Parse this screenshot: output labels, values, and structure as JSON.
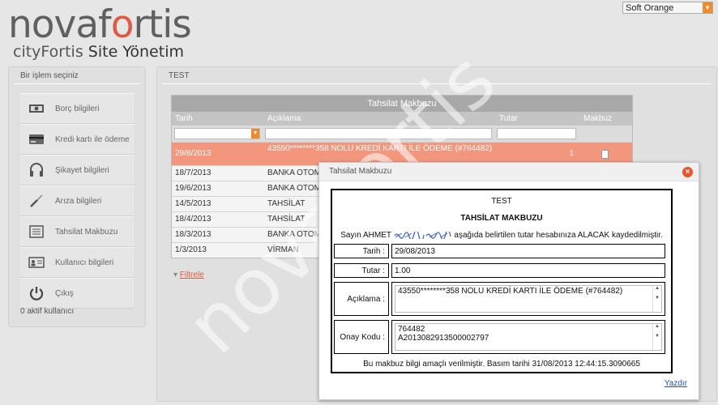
{
  "logo": {
    "brand": "novafortis",
    "tagline_prefix": "cityFortis",
    "tagline_rest": "Site Yönetim"
  },
  "theme": {
    "selected": "Soft Orange"
  },
  "left_panel": {
    "title": "Bir işlem seçiniz",
    "items": [
      {
        "label": "Borç bilgileri",
        "icon": "money-icon"
      },
      {
        "label": "Kredi kartı ile ödeme",
        "icon": "credit-card-icon"
      },
      {
        "label": "Şikayet bilgileri",
        "icon": "headset-icon"
      },
      {
        "label": "Arıza bilgileri",
        "icon": "screwdriver-icon"
      },
      {
        "label": "Tahsilat Makbuzu",
        "icon": "receipt-icon"
      },
      {
        "label": "Kullanıcı bilgileri",
        "icon": "user-card-icon"
      },
      {
        "label": "Çıkış",
        "icon": "power-icon"
      }
    ],
    "active_users": "0 aktif kullanıcı"
  },
  "main_panel": {
    "title": "TEST",
    "grid": {
      "caption": "Tahsilat Makbuzu",
      "columns": [
        "Tarih",
        "Açıklama",
        "Tutar",
        "Makbuz"
      ],
      "rows": [
        {
          "date": "29/8/2013",
          "desc": "43550********358 NOLU KREDİ KARTI İLE ÖDEME (#764482)",
          "amount": "1"
        },
        {
          "date": "18/7/2013",
          "desc": "BANKA OTOMA"
        },
        {
          "date": "19/6/2013",
          "desc": "BANKA OTOMA"
        },
        {
          "date": "14/5/2013",
          "desc": "TAHSİLAT"
        },
        {
          "date": "18/4/2013",
          "desc": "TAHSİLAT"
        },
        {
          "date": "18/3/2013",
          "desc": "BANKA OTOMA"
        },
        {
          "date": "1/3/2013",
          "desc": "VİRMAN"
        }
      ],
      "filter_link": "Filtrele"
    }
  },
  "watermark": "novafortis",
  "dialog": {
    "title": "Tahsilat Makbuzu",
    "close_label": "×",
    "receipt": {
      "site": "TEST",
      "heading": "TAHSİLAT MAKBUZU",
      "text_prefix": "Sayın AHMET",
      "text_suffix": "aşağıda belirtilen tutar hesabınıza ALACAK kaydedilmiştir.",
      "date_label": "Tarih :",
      "date_value": "29/08/2013",
      "amount_label": "Tutar :",
      "amount_value": "1.00",
      "desc_label": "Açıklama :",
      "desc_value": "43550********358 NOLU KREDİ KARTI İLE ÖDEME (#764482)",
      "approval_label": "Onay Kodu :",
      "approval_line1": "764482",
      "approval_line2": "A2013082913500002797",
      "footer": "Bu makbuz bilgi amaçlı verilmiştir. Basım tarihi 31/08/2013 12:44:15.3090665"
    },
    "print_link": "Yazdır"
  }
}
